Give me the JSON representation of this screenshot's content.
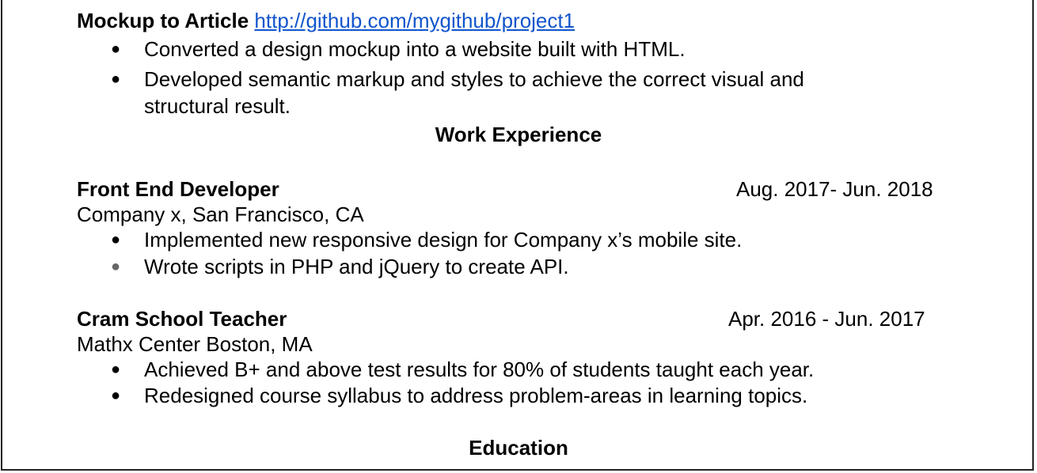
{
  "project": {
    "title": "Mockup to Article",
    "link": "http://github.com/mygithub/project1",
    "bullets": [
      "Converted a design mockup into a website built with HTML.",
      "Developed semantic markup and styles to achieve the correct visual and",
      "structural result."
    ]
  },
  "sections": {
    "work_experience": "Work Experience",
    "education": "Education"
  },
  "jobs": [
    {
      "title": "Front End Developer",
      "dates": "Aug. 2017- Jun. 2018",
      "company": "Company x, San Francisco, CA",
      "bullets": [
        "Implemented new responsive design for Company x’s mobile site.",
        "Wrote scripts in PHP and jQuery to create API."
      ]
    },
    {
      "title": "Cram School Teacher",
      "dates": "Apr. 2016 - Jun. 2017",
      "company": "Mathx Center Boston, MA",
      "bullets": [
        "Achieved B+ and above test results for 80% of students taught each year.",
        "Redesigned course syllabus to address problem-areas in learning topics."
      ]
    }
  ],
  "bullet_glyph": "●",
  "colors": {
    "link": "#1155cc",
    "text": "#000000",
    "grey_bullet": "#666666"
  }
}
